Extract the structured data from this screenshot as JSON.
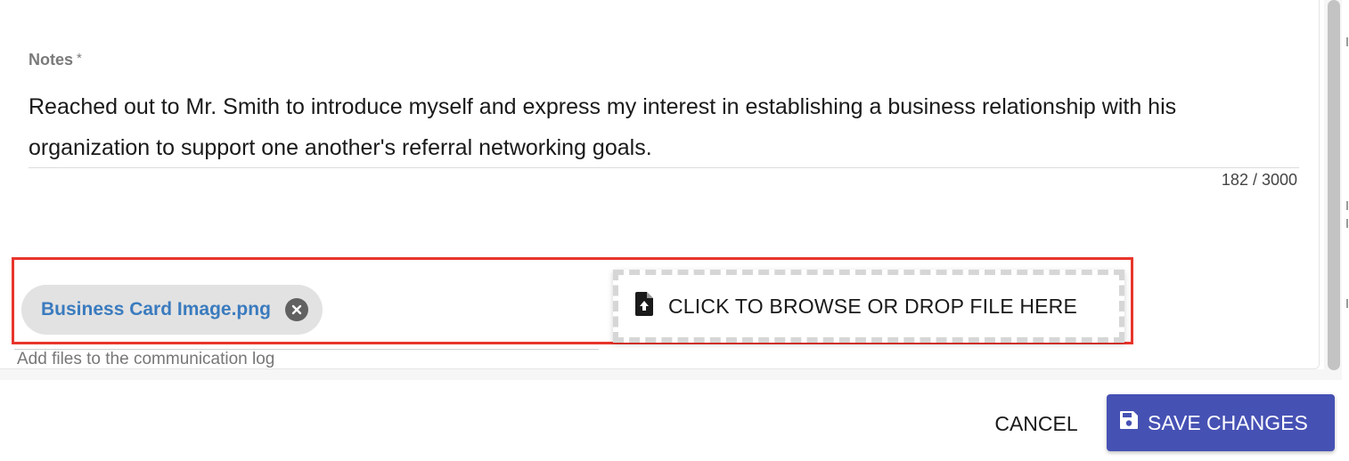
{
  "form": {
    "notes_label": "Notes",
    "required_marker": "*",
    "notes_value": "Reached out to Mr. Smith to introduce myself and express my interest in establishing a business relationship with his organization to support one another's referral networking goals.",
    "char_count": "182 / 3000"
  },
  "attachments": {
    "files": [
      {
        "name": "Business Card Image.png"
      }
    ],
    "dropzone_label": "CLICK TO BROWSE OR DROP FILE HERE",
    "helper_text": "Add files to the communication log",
    "highlight_color": "#e8352b"
  },
  "footer": {
    "cancel_label": "CANCEL",
    "save_label": "SAVE CHANGES",
    "save_color": "#4651b4"
  },
  "icons": {
    "chip_remove": "close-circle-icon",
    "dropzone": "file-upload-icon",
    "save": "floppy-disk-icon"
  }
}
